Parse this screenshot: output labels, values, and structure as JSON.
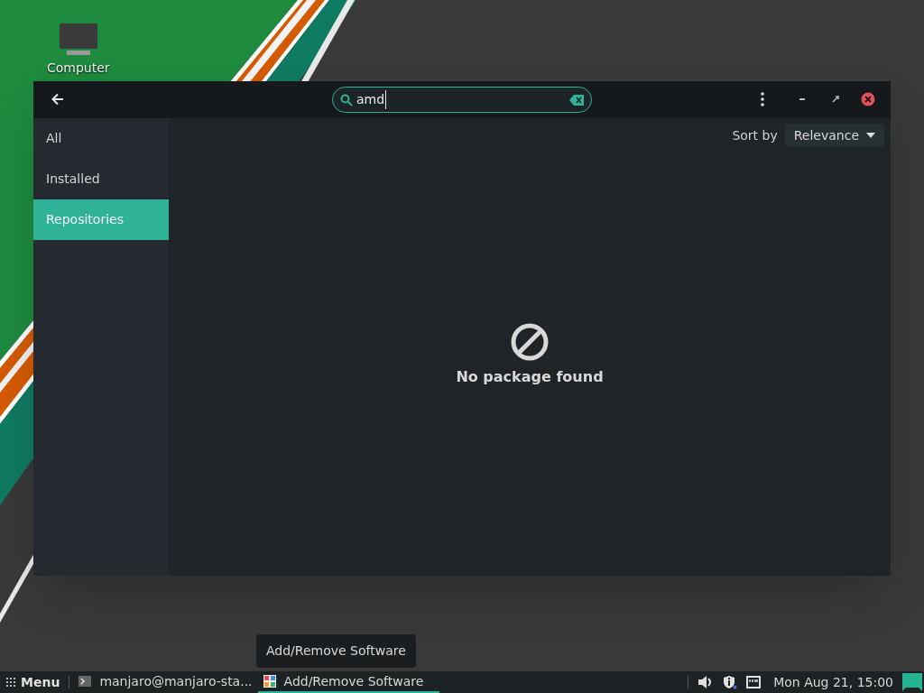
{
  "desktop_icons": [
    {
      "label": "Computer"
    }
  ],
  "window": {
    "search": {
      "value": "amd"
    },
    "sidebar": {
      "items": [
        {
          "label": "All",
          "selected": false
        },
        {
          "label": "Installed",
          "selected": false
        },
        {
          "label": "Repositories",
          "selected": true
        }
      ]
    },
    "sort": {
      "label": "Sort by",
      "value": "Relevance"
    },
    "empty_state": {
      "message": "No package found"
    }
  },
  "tooltip": "Add/Remove Software",
  "taskbar": {
    "menu": "Menu",
    "tasks": [
      {
        "label": "manjaro@manjaro-sta...",
        "kind": "terminal",
        "selected": false
      },
      {
        "label": "Add/Remove Software",
        "kind": "software",
        "selected": true
      }
    ],
    "clock": "Mon Aug 21, 15:00"
  }
}
